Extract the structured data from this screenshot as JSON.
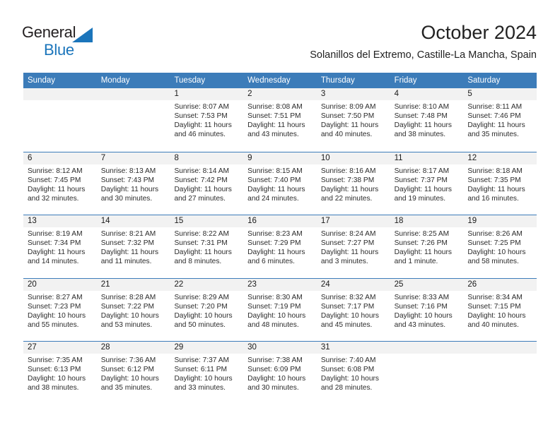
{
  "brand": {
    "name_part1": "General",
    "name_part2": "Blue",
    "logo_icon": "triangle-logo-icon",
    "color_primary": "#1b75bb",
    "color_text": "#231f20"
  },
  "header": {
    "title": "October 2024",
    "subtitle": "Solanillos del Extremo, Castille-La Mancha, Spain"
  },
  "theme": {
    "header_blue": "#3c7cb9",
    "day_number_bg": "#f2f2f2",
    "grid_line": "#3c7cb9"
  },
  "weekdays": [
    "Sunday",
    "Monday",
    "Tuesday",
    "Wednesday",
    "Thursday",
    "Friday",
    "Saturday"
  ],
  "weeks": [
    [
      {
        "day": "",
        "empty": true,
        "sunrise": "",
        "sunset": "",
        "daylight_line1": "",
        "daylight_line2": ""
      },
      {
        "day": "",
        "empty": true,
        "sunrise": "",
        "sunset": "",
        "daylight_line1": "",
        "daylight_line2": ""
      },
      {
        "day": "1",
        "sunrise": "Sunrise: 8:07 AM",
        "sunset": "Sunset: 7:53 PM",
        "daylight_line1": "Daylight: 11 hours",
        "daylight_line2": "and 46 minutes."
      },
      {
        "day": "2",
        "sunrise": "Sunrise: 8:08 AM",
        "sunset": "Sunset: 7:51 PM",
        "daylight_line1": "Daylight: 11 hours",
        "daylight_line2": "and 43 minutes."
      },
      {
        "day": "3",
        "sunrise": "Sunrise: 8:09 AM",
        "sunset": "Sunset: 7:50 PM",
        "daylight_line1": "Daylight: 11 hours",
        "daylight_line2": "and 40 minutes."
      },
      {
        "day": "4",
        "sunrise": "Sunrise: 8:10 AM",
        "sunset": "Sunset: 7:48 PM",
        "daylight_line1": "Daylight: 11 hours",
        "daylight_line2": "and 38 minutes."
      },
      {
        "day": "5",
        "sunrise": "Sunrise: 8:11 AM",
        "sunset": "Sunset: 7:46 PM",
        "daylight_line1": "Daylight: 11 hours",
        "daylight_line2": "and 35 minutes."
      }
    ],
    [
      {
        "day": "6",
        "sunrise": "Sunrise: 8:12 AM",
        "sunset": "Sunset: 7:45 PM",
        "daylight_line1": "Daylight: 11 hours",
        "daylight_line2": "and 32 minutes."
      },
      {
        "day": "7",
        "sunrise": "Sunrise: 8:13 AM",
        "sunset": "Sunset: 7:43 PM",
        "daylight_line1": "Daylight: 11 hours",
        "daylight_line2": "and 30 minutes."
      },
      {
        "day": "8",
        "sunrise": "Sunrise: 8:14 AM",
        "sunset": "Sunset: 7:42 PM",
        "daylight_line1": "Daylight: 11 hours",
        "daylight_line2": "and 27 minutes."
      },
      {
        "day": "9",
        "sunrise": "Sunrise: 8:15 AM",
        "sunset": "Sunset: 7:40 PM",
        "daylight_line1": "Daylight: 11 hours",
        "daylight_line2": "and 24 minutes."
      },
      {
        "day": "10",
        "sunrise": "Sunrise: 8:16 AM",
        "sunset": "Sunset: 7:38 PM",
        "daylight_line1": "Daylight: 11 hours",
        "daylight_line2": "and 22 minutes."
      },
      {
        "day": "11",
        "sunrise": "Sunrise: 8:17 AM",
        "sunset": "Sunset: 7:37 PM",
        "daylight_line1": "Daylight: 11 hours",
        "daylight_line2": "and 19 minutes."
      },
      {
        "day": "12",
        "sunrise": "Sunrise: 8:18 AM",
        "sunset": "Sunset: 7:35 PM",
        "daylight_line1": "Daylight: 11 hours",
        "daylight_line2": "and 16 minutes."
      }
    ],
    [
      {
        "day": "13",
        "sunrise": "Sunrise: 8:19 AM",
        "sunset": "Sunset: 7:34 PM",
        "daylight_line1": "Daylight: 11 hours",
        "daylight_line2": "and 14 minutes."
      },
      {
        "day": "14",
        "sunrise": "Sunrise: 8:21 AM",
        "sunset": "Sunset: 7:32 PM",
        "daylight_line1": "Daylight: 11 hours",
        "daylight_line2": "and 11 minutes."
      },
      {
        "day": "15",
        "sunrise": "Sunrise: 8:22 AM",
        "sunset": "Sunset: 7:31 PM",
        "daylight_line1": "Daylight: 11 hours",
        "daylight_line2": "and 8 minutes."
      },
      {
        "day": "16",
        "sunrise": "Sunrise: 8:23 AM",
        "sunset": "Sunset: 7:29 PM",
        "daylight_line1": "Daylight: 11 hours",
        "daylight_line2": "and 6 minutes."
      },
      {
        "day": "17",
        "sunrise": "Sunrise: 8:24 AM",
        "sunset": "Sunset: 7:27 PM",
        "daylight_line1": "Daylight: 11 hours",
        "daylight_line2": "and 3 minutes."
      },
      {
        "day": "18",
        "sunrise": "Sunrise: 8:25 AM",
        "sunset": "Sunset: 7:26 PM",
        "daylight_line1": "Daylight: 11 hours",
        "daylight_line2": "and 1 minute."
      },
      {
        "day": "19",
        "sunrise": "Sunrise: 8:26 AM",
        "sunset": "Sunset: 7:25 PM",
        "daylight_line1": "Daylight: 10 hours",
        "daylight_line2": "and 58 minutes."
      }
    ],
    [
      {
        "day": "20",
        "sunrise": "Sunrise: 8:27 AM",
        "sunset": "Sunset: 7:23 PM",
        "daylight_line1": "Daylight: 10 hours",
        "daylight_line2": "and 55 minutes."
      },
      {
        "day": "21",
        "sunrise": "Sunrise: 8:28 AM",
        "sunset": "Sunset: 7:22 PM",
        "daylight_line1": "Daylight: 10 hours",
        "daylight_line2": "and 53 minutes."
      },
      {
        "day": "22",
        "sunrise": "Sunrise: 8:29 AM",
        "sunset": "Sunset: 7:20 PM",
        "daylight_line1": "Daylight: 10 hours",
        "daylight_line2": "and 50 minutes."
      },
      {
        "day": "23",
        "sunrise": "Sunrise: 8:30 AM",
        "sunset": "Sunset: 7:19 PM",
        "daylight_line1": "Daylight: 10 hours",
        "daylight_line2": "and 48 minutes."
      },
      {
        "day": "24",
        "sunrise": "Sunrise: 8:32 AM",
        "sunset": "Sunset: 7:17 PM",
        "daylight_line1": "Daylight: 10 hours",
        "daylight_line2": "and 45 minutes."
      },
      {
        "day": "25",
        "sunrise": "Sunrise: 8:33 AM",
        "sunset": "Sunset: 7:16 PM",
        "daylight_line1": "Daylight: 10 hours",
        "daylight_line2": "and 43 minutes."
      },
      {
        "day": "26",
        "sunrise": "Sunrise: 8:34 AM",
        "sunset": "Sunset: 7:15 PM",
        "daylight_line1": "Daylight: 10 hours",
        "daylight_line2": "and 40 minutes."
      }
    ],
    [
      {
        "day": "27",
        "sunrise": "Sunrise: 7:35 AM",
        "sunset": "Sunset: 6:13 PM",
        "daylight_line1": "Daylight: 10 hours",
        "daylight_line2": "and 38 minutes."
      },
      {
        "day": "28",
        "sunrise": "Sunrise: 7:36 AM",
        "sunset": "Sunset: 6:12 PM",
        "daylight_line1": "Daylight: 10 hours",
        "daylight_line2": "and 35 minutes."
      },
      {
        "day": "29",
        "sunrise": "Sunrise: 7:37 AM",
        "sunset": "Sunset: 6:11 PM",
        "daylight_line1": "Daylight: 10 hours",
        "daylight_line2": "and 33 minutes."
      },
      {
        "day": "30",
        "sunrise": "Sunrise: 7:38 AM",
        "sunset": "Sunset: 6:09 PM",
        "daylight_line1": "Daylight: 10 hours",
        "daylight_line2": "and 30 minutes."
      },
      {
        "day": "31",
        "sunrise": "Sunrise: 7:40 AM",
        "sunset": "Sunset: 6:08 PM",
        "daylight_line1": "Daylight: 10 hours",
        "daylight_line2": "and 28 minutes."
      },
      {
        "day": "",
        "empty": true,
        "sunrise": "",
        "sunset": "",
        "daylight_line1": "",
        "daylight_line2": ""
      },
      {
        "day": "",
        "empty": true,
        "sunrise": "",
        "sunset": "",
        "daylight_line1": "",
        "daylight_line2": ""
      }
    ]
  ]
}
